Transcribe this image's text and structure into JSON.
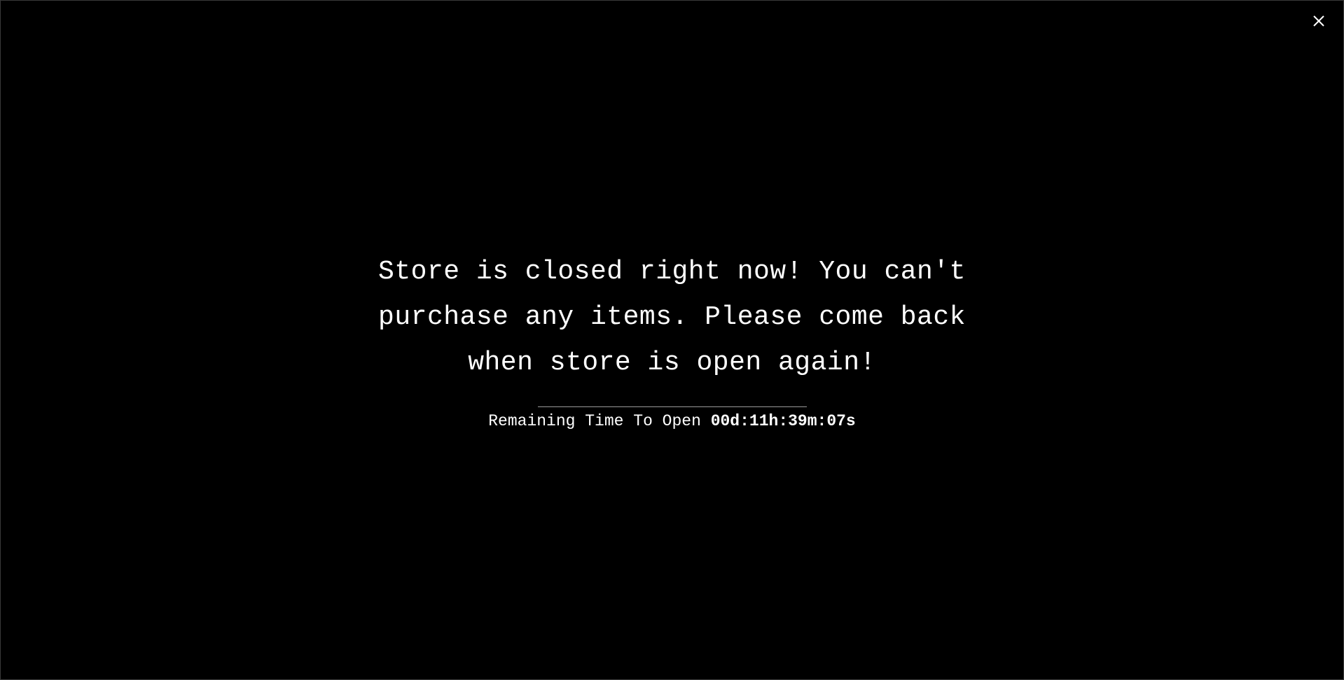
{
  "modal": {
    "close_icon": "close-icon",
    "message": "Store is closed right now! You can't purchase any items. Please come back when store is open again!",
    "countdown_label": "Remaining Time To Open",
    "countdown_value": "00d:11h:39m:07s"
  },
  "colors": {
    "background": "#000000",
    "text": "#ffffff",
    "divider": "#9a9a9a"
  }
}
